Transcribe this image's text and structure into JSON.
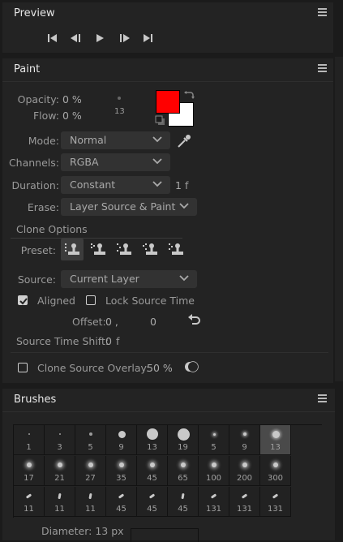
{
  "preview": {
    "title": "Preview",
    "buttons": [
      "first-frame",
      "previous-frame",
      "play",
      "next-frame",
      "last-frame"
    ]
  },
  "paint": {
    "title": "Paint",
    "opacity_label": "Opacity:",
    "opacity_value": "0 %",
    "flow_label": "Flow:",
    "flow_value": "0 %",
    "brush_size": "13",
    "foreground_color": "#ff0000",
    "background_color": "#ffffff",
    "mode_label": "Mode:",
    "mode_value": "Normal",
    "channels_label": "Channels:",
    "channels_value": "RGBA",
    "duration_label": "Duration:",
    "duration_value": "Constant",
    "duration_frames": "1",
    "duration_unit": "f",
    "erase_label": "Erase:",
    "erase_value": "Layer Source & Paint",
    "clone_options_label": "Clone Options",
    "preset_label": "Preset:",
    "source_label": "Source:",
    "source_value": "Current Layer",
    "aligned_label": "Aligned",
    "aligned_checked": true,
    "lock_source_time_label": "Lock Source Time",
    "lock_source_time_checked": false,
    "offset_label": "Offset:",
    "offset_x": "0 ,",
    "offset_y": "0",
    "source_time_shift_label": "Source Time Shift:",
    "source_time_shift_value": "0",
    "source_time_shift_unit": "f",
    "clone_overlay_label": "Clone Source Overlay:",
    "clone_overlay_value": "50 %",
    "clone_overlay_checked": false
  },
  "brushes": {
    "title": "Brushes",
    "items": [
      {
        "size": "1",
        "hard": true
      },
      {
        "size": "3",
        "hard": true
      },
      {
        "size": "5",
        "hard": true
      },
      {
        "size": "9",
        "hard": true
      },
      {
        "size": "13",
        "hard": true
      },
      {
        "size": "19",
        "hard": true
      },
      {
        "size": "5",
        "hard": false
      },
      {
        "size": "9",
        "hard": false
      },
      {
        "size": "13",
        "hard": false,
        "selected": true
      },
      {
        "size": "17"
      },
      {
        "size": "21"
      },
      {
        "size": "27"
      },
      {
        "size": "35"
      },
      {
        "size": "45"
      },
      {
        "size": "65"
      },
      {
        "size": "100"
      },
      {
        "size": "200"
      },
      {
        "size": "300"
      },
      {
        "size": "11"
      },
      {
        "size": "11"
      },
      {
        "size": "11"
      },
      {
        "size": "45"
      },
      {
        "size": "45"
      },
      {
        "size": "45"
      },
      {
        "size": "131"
      },
      {
        "size": "131"
      },
      {
        "size": "131"
      }
    ],
    "diameter_label": "Diameter: 13 px"
  }
}
